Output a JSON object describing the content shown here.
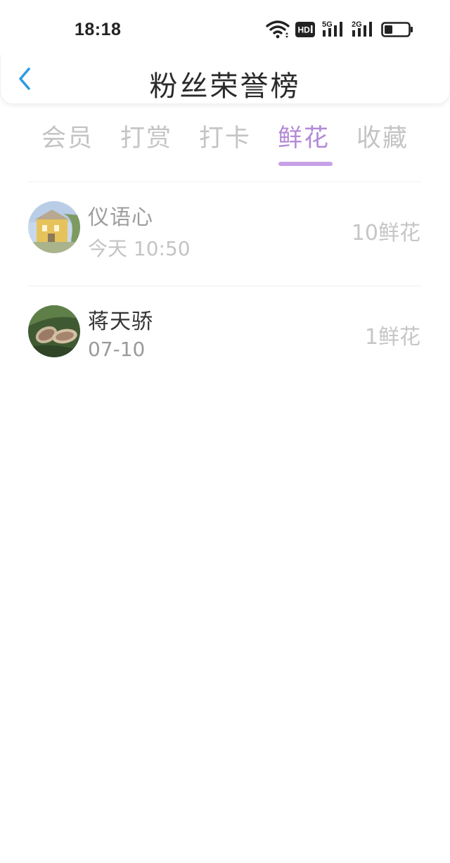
{
  "status_bar": {
    "time": "18:18",
    "hd_label": "HD",
    "network_5g": "5G",
    "network_2g": "2G",
    "icons": [
      "wifi-icon",
      "hd-icon",
      "signal-5g-icon",
      "signal-2g-icon",
      "battery-icon"
    ]
  },
  "header": {
    "title": "粉丝荣誉榜",
    "back_icon": "chevron-left-icon",
    "back_color": "#2f9be6"
  },
  "tabs": [
    {
      "label": "会员",
      "active": false
    },
    {
      "label": "打赏",
      "active": false
    },
    {
      "label": "打卡",
      "active": false
    },
    {
      "label": "鲜花",
      "active": true
    },
    {
      "label": "收藏",
      "active": false
    }
  ],
  "accent_color": "#b38ad6",
  "list": [
    {
      "name": "仪语心",
      "time": "今天 10:50",
      "value": "10鲜花",
      "avatar": "house-photo-avatar"
    },
    {
      "name": "蒋天骄",
      "time": "07-10",
      "value": "1鲜花",
      "avatar": "leaves-photo-avatar"
    }
  ]
}
